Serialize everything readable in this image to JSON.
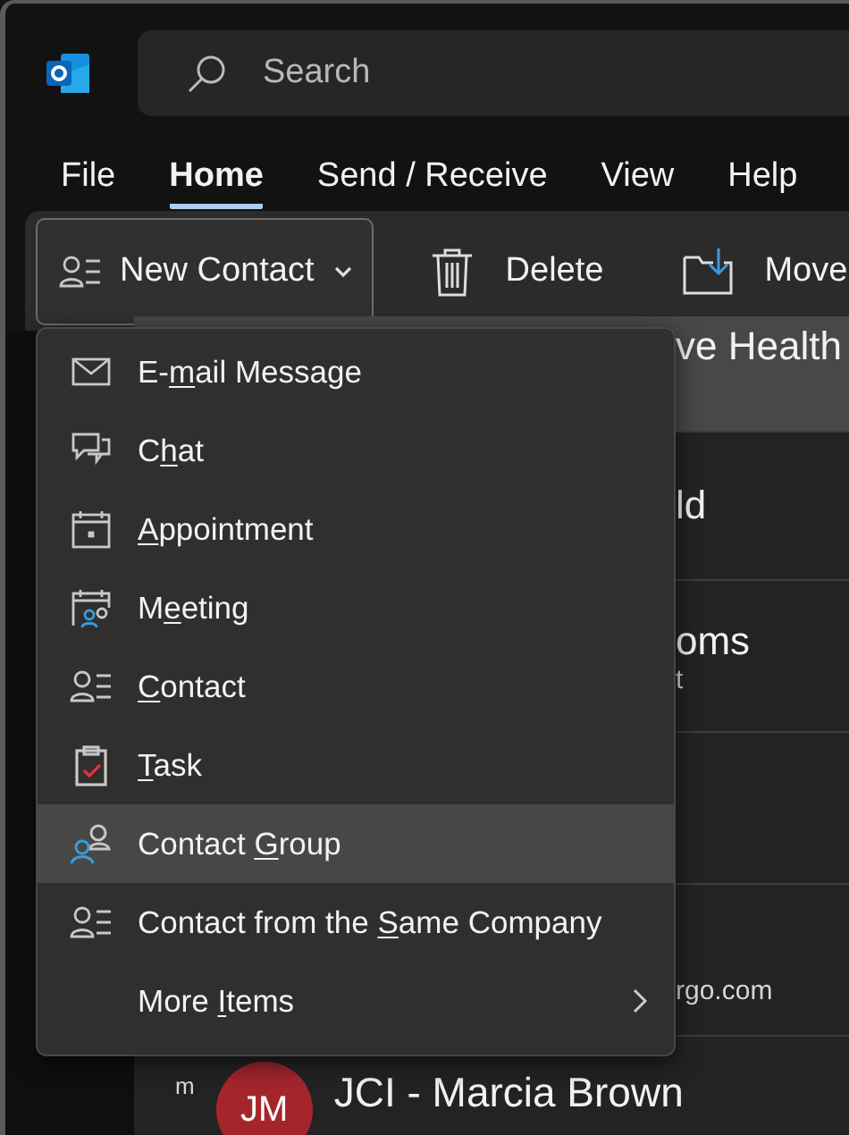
{
  "search": {
    "placeholder": "Search"
  },
  "tabs": [
    {
      "label": "File",
      "selected": false
    },
    {
      "label": "Home",
      "selected": true
    },
    {
      "label": "Send / Receive",
      "selected": false
    },
    {
      "label": "View",
      "selected": false
    },
    {
      "label": "Help",
      "selected": false
    }
  ],
  "ribbon": {
    "new_button": {
      "label": "New Contact"
    },
    "buttons": [
      {
        "kind": "delete",
        "label": "Delete"
      },
      {
        "kind": "move",
        "label": "Move"
      }
    ]
  },
  "list": {
    "rows": [
      {
        "title": "ve Health",
        "selected": true
      },
      {
        "title": "ld",
        "selected": false
      },
      {
        "title": "oms",
        "subtitle": "t",
        "selected": false
      },
      {
        "subtitle": "rgo.com",
        "selected": false
      }
    ],
    "contact": {
      "prefix": "m",
      "initials": "JM",
      "name": "JCI - Marcia Brown",
      "color": "#a4262c"
    }
  },
  "dropdown": {
    "items": [
      {
        "kind": "email",
        "before": "E-",
        "key": "m",
        "after": "ail Message",
        "selected": false
      },
      {
        "kind": "chat",
        "before": "C",
        "key": "h",
        "after": "at",
        "selected": false
      },
      {
        "kind": "appointment",
        "key": "A",
        "after": "ppointment",
        "selected": false
      },
      {
        "kind": "meeting",
        "before": "M",
        "key": "e",
        "after": "eting",
        "selected": false
      },
      {
        "kind": "contact",
        "key": "C",
        "after": "ontact",
        "selected": false
      },
      {
        "kind": "task",
        "key": "T",
        "after": "ask",
        "selected": false
      },
      {
        "kind": "group",
        "before": "Contact ",
        "key": "G",
        "after": "roup",
        "selected": true
      },
      {
        "kind": "company",
        "before": "Contact from the ",
        "key": "S",
        "after": "ame Company",
        "selected": false
      },
      {
        "kind": "more",
        "before": "More ",
        "key": "I",
        "after": "tems",
        "selected": false
      }
    ]
  }
}
